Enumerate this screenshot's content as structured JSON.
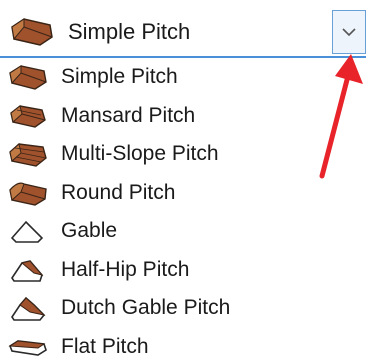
{
  "combo": {
    "selected_label": "Simple Pitch",
    "selected_icon": "simple-pitch-roof-icon",
    "dropdown_icon": "chevron-down-icon",
    "focus_color": "#4a90d9"
  },
  "menu": {
    "items": [
      {
        "label": "Simple Pitch",
        "icon": "simple-pitch-roof-icon"
      },
      {
        "label": "Mansard Pitch",
        "icon": "mansard-roof-icon"
      },
      {
        "label": "Multi-Slope Pitch",
        "icon": "multi-slope-roof-icon"
      },
      {
        "label": "Round Pitch",
        "icon": "round-roof-icon"
      },
      {
        "label": "Gable",
        "icon": "gable-outline-icon"
      },
      {
        "label": "Half-Hip Pitch",
        "icon": "half-hip-roof-icon"
      },
      {
        "label": "Dutch Gable Pitch",
        "icon": "dutch-gable-roof-icon"
      },
      {
        "label": "Flat Pitch",
        "icon": "flat-roof-icon"
      }
    ]
  },
  "annotation": {
    "arrow_color": "#e8232a",
    "arrow_icon": "red-arrow-icon"
  },
  "colors": {
    "roof_brown": "#a0522d",
    "roof_dark": "#6b3a1f",
    "text": "#1a1a1a"
  }
}
